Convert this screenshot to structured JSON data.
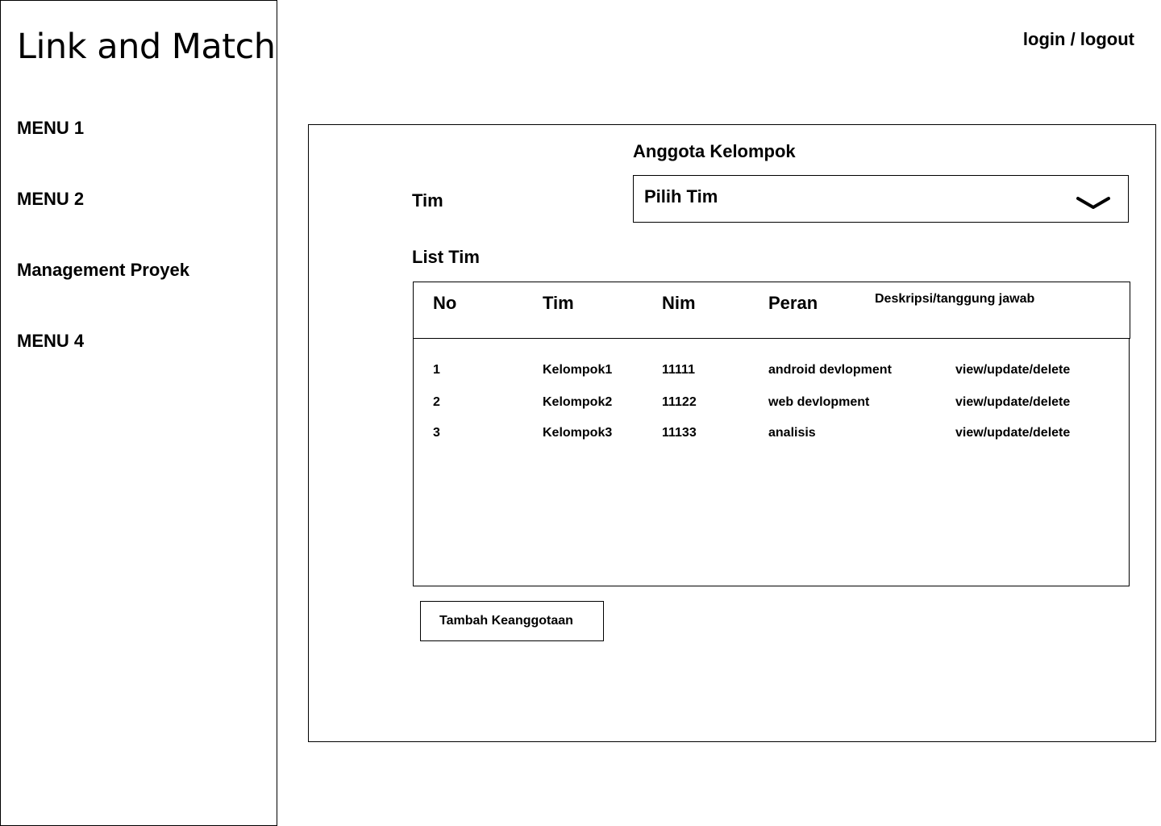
{
  "sidebar": {
    "brand": "Link and Match",
    "items": [
      {
        "label": "MENU 1"
      },
      {
        "label": "MENU 2"
      },
      {
        "label": "Management Proyek"
      },
      {
        "label": "MENU 4"
      }
    ]
  },
  "header": {
    "auth_link": "login / logout"
  },
  "main": {
    "title": "Anggota Kelompok",
    "team_label": "Tim",
    "team_select": {
      "value": "Pilih Tim",
      "icon": "chevron-down-icon"
    },
    "list_label": "List Tim",
    "table": {
      "headers": [
        "No",
        "Tim",
        "Nim",
        "Peran",
        "Deskripsi/tanggung jawab"
      ],
      "rows": [
        {
          "no": "1",
          "tim": "Kelompok1",
          "nim": "11111",
          "peran": "android devlopment",
          "action": "view/update/delete"
        },
        {
          "no": "2",
          "tim": "Kelompok2",
          "nim": "11122",
          "peran": "web devlopment",
          "action": "view/update/delete"
        },
        {
          "no": "3",
          "tim": "Kelompok3",
          "nim": "11133",
          "peran": "analisis",
          "action": "view/update/delete"
        }
      ]
    },
    "add_button": "Tambah Keanggotaan"
  }
}
